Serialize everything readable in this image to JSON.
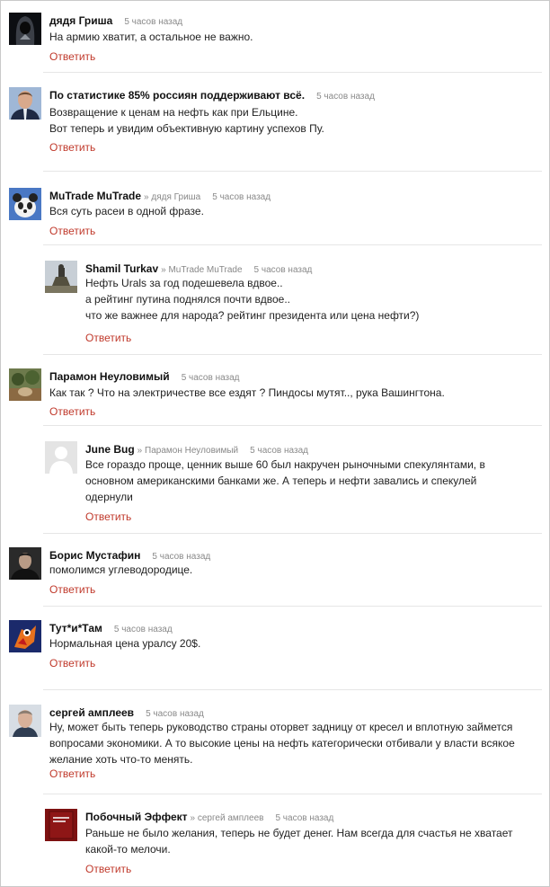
{
  "comments": [
    {
      "author": "дядя Гриша",
      "time": "5 часов назад",
      "lines": [
        "На армию хватит, а остальное не важно."
      ],
      "reply": "Ответить"
    },
    {
      "author": "По статистике 85% россиян поддерживают всё.",
      "time": "5 часов назад",
      "lines": [
        "Возвращение к ценам на нефть как при Ельцине.",
        "Вот теперь и увидим объективную картину успехов Пу."
      ],
      "reply": "Ответить"
    },
    {
      "author": "MuTrade MuTrade",
      "reply_to": "» дядя Гриша",
      "time": "5 часов назад",
      "lines": [
        "Вся суть расеи в одной фразе."
      ],
      "reply": "Ответить"
    },
    {
      "author": "Shamil Turkav",
      "reply_to": "» MuTrade MuTrade",
      "time": "5 часов назад",
      "lines": [
        "Нефть Urals за год подешевела вдвое..",
        "а рейтинг путина поднялся почти вдвое..",
        "что же важнее для народа? рейтинг президента или цена нефти?)"
      ],
      "reply": "Ответить"
    },
    {
      "author": "Парамон Неуловимый",
      "time": "5 часов назад",
      "lines": [
        "Как так ? Что на электричестве все ездят ? Пиндосы мутят.., рука Вашингтона."
      ],
      "reply": "Ответить"
    },
    {
      "author": "June Bug",
      "reply_to": "» Парамон Неуловимый",
      "time": "5 часов назад",
      "lines": [
        "Все гораздо проще, ценник выше 60 был накручен рыночными спекулянтами, в",
        "основном американскими банками же. А теперь и нефти завались и спекулей",
        "одернули"
      ],
      "reply": "Ответить"
    },
    {
      "author": "Борис Мустафин",
      "time": "5 часов назад",
      "lines": [
        "помолимся углеводородице."
      ],
      "reply": "Ответить"
    },
    {
      "author": "Тут*и*Там",
      "time": "5 часов назад",
      "lines": [
        "Нормальная цена уралсу 20$."
      ],
      "reply": "Ответить"
    },
    {
      "author": "сергей амплеев",
      "time": "5 часов назад",
      "lines": [
        "Ну, может быть теперь руководство страны оторвет задницу от кресел и вплотную займется",
        "вопросами экономики. А то высокие цены на нефть категорически отбивали у власти всякое",
        "желание хоть что-то менять."
      ],
      "reply": "Ответить"
    },
    {
      "author": "Побочный Эффект",
      "reply_to": "» сергей амплеев",
      "time": "5 часов назад",
      "lines": [
        "Раньше не было желания, теперь не будет денег. Нам всегда для счастья не хватает",
        "какой-то мелочи."
      ],
      "reply": "Ответить"
    }
  ],
  "colors": {
    "link": "#c0392b",
    "meta": "#8a8a8a",
    "separator": "#e6e6e6",
    "border": "#c9c9c9"
  },
  "icons": [
    "hooded-figure-avatar",
    "politician-avatar",
    "panda-avatar",
    "monument-avatar",
    "forest-avatar",
    "default-user-avatar",
    "man-portrait-avatar",
    "cartoon-parrot-avatar",
    "man-face-avatar",
    "book-cover-avatar"
  ]
}
